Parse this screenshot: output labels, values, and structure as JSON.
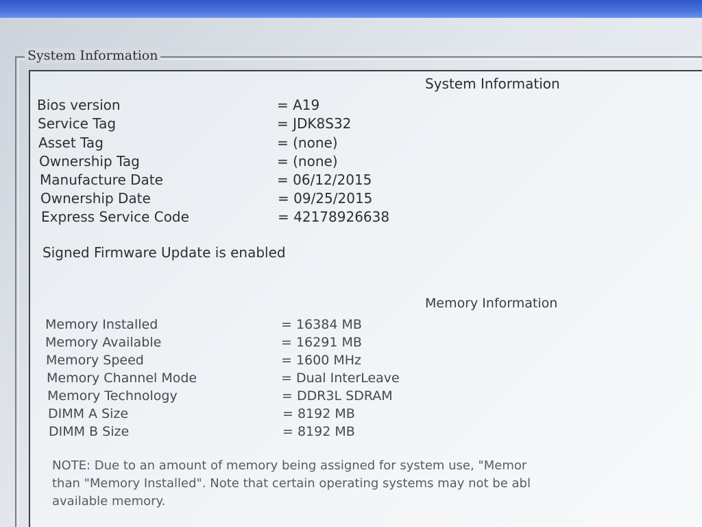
{
  "group": {
    "legend": "System Information"
  },
  "system": {
    "title": "System Information",
    "rows": [
      {
        "label": "Bios version",
        "value": "= A19"
      },
      {
        "label": "Service Tag",
        "value": "= JDK8S32"
      },
      {
        "label": "Asset Tag",
        "value": "= (none)"
      },
      {
        "label": "Ownership Tag",
        "value": "= (none)"
      },
      {
        "label": "Manufacture Date",
        "value": "= 06/12/2015"
      },
      {
        "label": "Ownership Date",
        "value": "= 09/25/2015"
      },
      {
        "label": "Express Service Code",
        "value": "= 42178926638"
      }
    ],
    "status": "Signed Firmware Update is enabled"
  },
  "memory": {
    "title": "Memory Information",
    "rows": [
      {
        "label": "Memory Installed",
        "value": "= 16384 MB"
      },
      {
        "label": "Memory Available",
        "value": "= 16291 MB"
      },
      {
        "label": "Memory Speed",
        "value": "= 1600 MHz"
      },
      {
        "label": "Memory Channel Mode",
        "value": "= Dual InterLeave"
      },
      {
        "label": "Memory Technology",
        "value": "= DDR3L SDRAM"
      },
      {
        "label": "DIMM A Size",
        "value": "= 8192 MB"
      },
      {
        "label": "DIMM B Size",
        "value": "= 8192 MB"
      }
    ],
    "note_lines": [
      "NOTE: Due to an amount of memory being assigned for system use, \"Memor",
      "than \"Memory Installed\". Note that certain operating systems may not be abl",
      "available memory."
    ]
  }
}
